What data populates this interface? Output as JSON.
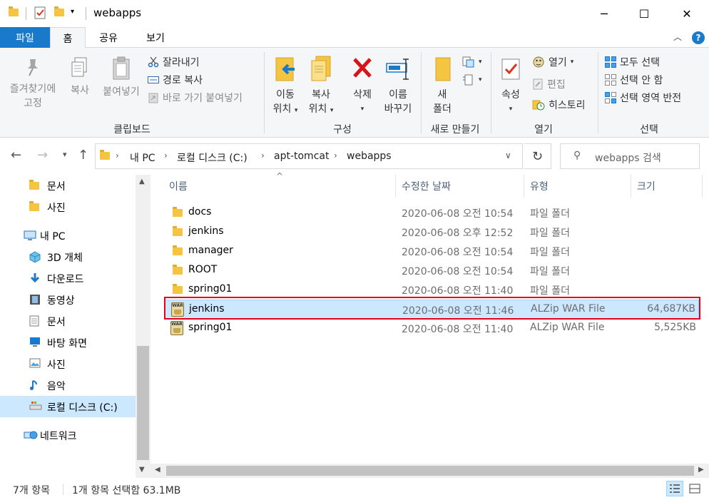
{
  "window": {
    "title": "webapps",
    "controls": {
      "minimize": "─",
      "maximize": "☐",
      "close": "✕"
    }
  },
  "ribbon_tabs": {
    "file": "파일",
    "home": "홈",
    "share": "공유",
    "view": "보기",
    "help": "?"
  },
  "ribbon": {
    "clipboard": {
      "label": "클립보드",
      "pin_line1": "즐겨찾기에",
      "pin_line2": "고정",
      "copy": "복사",
      "paste": "붙여넣기",
      "cut": "잘라내기",
      "copy_path": "경로 복사",
      "paste_shortcut": "바로 가기 붙여넣기"
    },
    "organize": {
      "label": "구성",
      "move_line1": "이동",
      "move_line2": "위치",
      "copyto_line1": "복사",
      "copyto_line2": "위치",
      "delete": "삭제",
      "rename_line1": "이름",
      "rename_line2": "바꾸기"
    },
    "new": {
      "label": "새로 만들기",
      "folder_line1": "새",
      "folder_line2": "폴더"
    },
    "open": {
      "label": "열기",
      "properties": "속성",
      "open": "열기",
      "edit": "편집",
      "history": "히스토리"
    },
    "select": {
      "label": "선택",
      "select_all": "모두 선택",
      "select_none": "선택 안 함",
      "invert": "선택 영역 반전"
    }
  },
  "address": {
    "crumbs": [
      "내 PC",
      "로컬 디스크 (C:)",
      "apt-tomcat",
      "webapps"
    ],
    "search_placeholder": "webapps 검색"
  },
  "nav": {
    "items": [
      {
        "label": "문서",
        "icon": "folder-icon",
        "indent": 1
      },
      {
        "label": "사진",
        "icon": "folder-icon",
        "indent": 1
      },
      {
        "label": "내 PC",
        "icon": "pc-icon",
        "indent": 0
      },
      {
        "label": "3D 개체",
        "icon": "3d-objects-icon",
        "indent": 1
      },
      {
        "label": "다운로드",
        "icon": "download-icon",
        "indent": 1
      },
      {
        "label": "동영상",
        "icon": "video-icon",
        "indent": 1
      },
      {
        "label": "문서",
        "icon": "document-icon",
        "indent": 1
      },
      {
        "label": "바탕 화면",
        "icon": "desktop-icon",
        "indent": 1
      },
      {
        "label": "사진",
        "icon": "pictures-icon",
        "indent": 1
      },
      {
        "label": "음악",
        "icon": "music-icon",
        "indent": 1
      },
      {
        "label": "로컬 디스크 (C:)",
        "icon": "drive-icon",
        "indent": 1,
        "selected": true
      },
      {
        "label": "네트워크",
        "icon": "network-icon",
        "indent": 0
      }
    ]
  },
  "columns": {
    "name": "이름",
    "modified": "수정한 날짜",
    "type": "유형",
    "size": "크기"
  },
  "files": [
    {
      "name": "docs",
      "modified": "2020-06-08 오전 10:54",
      "type": "파일 폴더",
      "size": "",
      "icon": "folder-icon"
    },
    {
      "name": "jenkins",
      "modified": "2020-06-08 오후 12:52",
      "type": "파일 폴더",
      "size": "",
      "icon": "folder-icon"
    },
    {
      "name": "manager",
      "modified": "2020-06-08 오전 10:54",
      "type": "파일 폴더",
      "size": "",
      "icon": "folder-icon"
    },
    {
      "name": "ROOT",
      "modified": "2020-06-08 오전 10:54",
      "type": "파일 폴더",
      "size": "",
      "icon": "folder-icon"
    },
    {
      "name": "spring01",
      "modified": "2020-06-08 오전 11:40",
      "type": "파일 폴더",
      "size": "",
      "icon": "folder-icon"
    },
    {
      "name": "jenkins",
      "modified": "2020-06-08 오전 11:46",
      "type": "ALZip WAR File",
      "size": "64,687KB",
      "icon": "war-file-icon",
      "selected": true
    },
    {
      "name": "spring01",
      "modified": "2020-06-08 오전 11:40",
      "type": "ALZip WAR File",
      "size": "5,525KB",
      "icon": "war-file-icon"
    }
  ],
  "war_icon_text": "WAR",
  "status": {
    "item_count": "7개 항목",
    "selection": "1개 항목 선택함 63.1MB"
  },
  "colors": {
    "accent": "#1979ca",
    "selection": "#cce8ff",
    "highlight_border": "#e3001b"
  }
}
